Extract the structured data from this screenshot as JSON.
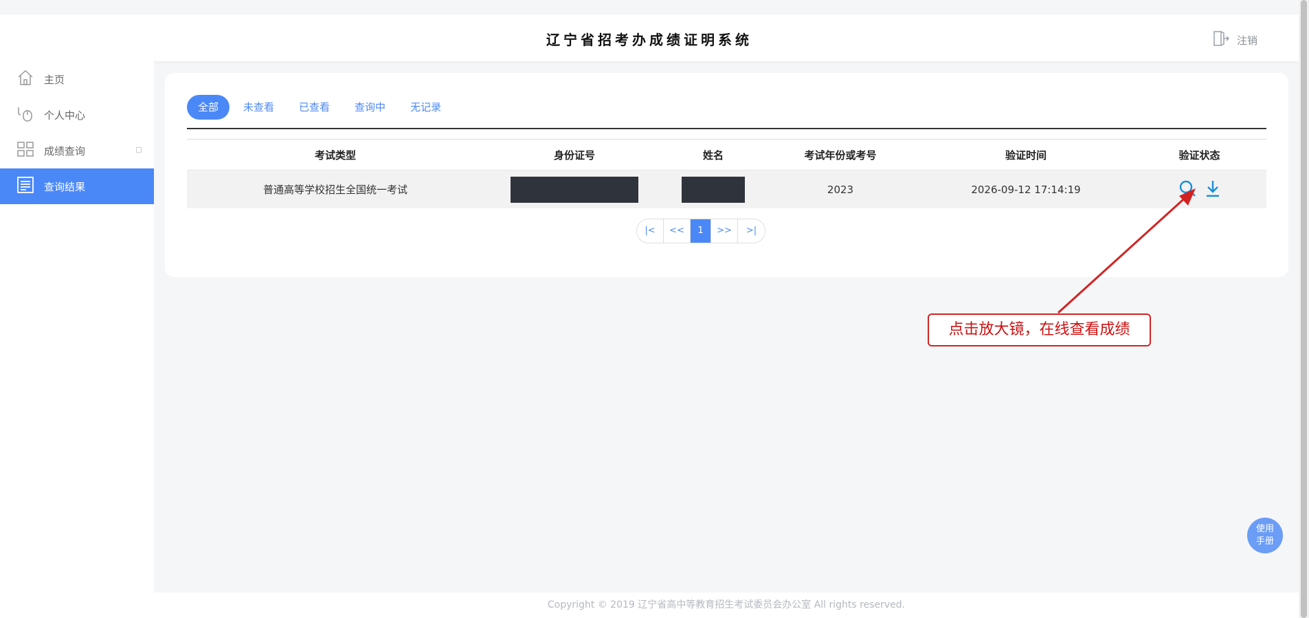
{
  "header": {
    "title": "辽宁省招考办成绩证明系统",
    "logout_label": "注销"
  },
  "sidebar": {
    "items": [
      {
        "label": "主页",
        "icon": "home-icon"
      },
      {
        "label": "个人中心",
        "icon": "mouse-icon"
      },
      {
        "label": "成绩查询",
        "icon": "grid-icon"
      },
      {
        "label": "查询结果",
        "icon": "document-list-icon",
        "active": true
      }
    ]
  },
  "tabs": [
    {
      "label": "全部",
      "active": true
    },
    {
      "label": "未查看"
    },
    {
      "label": "已查看"
    },
    {
      "label": "查询中"
    },
    {
      "label": "无记录"
    }
  ],
  "table": {
    "headers": [
      "考试类型",
      "身份证号",
      "姓名",
      "考试年份或考号",
      "验证时间",
      "验证状态"
    ],
    "rows": [
      {
        "exam_type": "普通高等学校招生全国统一考试",
        "id_number": "",
        "name": "",
        "year": "2023",
        "verify_time": "2026-09-12 17:14:19"
      }
    ]
  },
  "pager": {
    "first": "|<",
    "prev": "<<",
    "current": "1",
    "next": ">>",
    "last": ">|"
  },
  "annotation": {
    "text": "点击放大镜，在线查看成绩"
  },
  "manual_button": {
    "line1": "使用",
    "line2": "手册"
  },
  "footer": {
    "copyright": "Copyright © 2019 辽宁省高中等教育招生考试委员会办公室 All rights reserved."
  },
  "colors": {
    "primary": "#4b88f7",
    "annotation": "#d32222",
    "icon_blue": "#1a8fd6"
  }
}
